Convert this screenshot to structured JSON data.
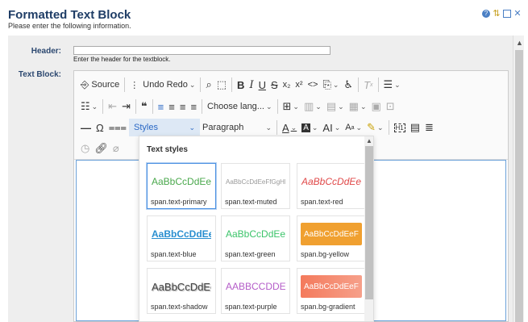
{
  "page": {
    "title": "Formatted Text Block",
    "subtitle": "Please enter the following information."
  },
  "form": {
    "header_label": "Header:",
    "header_value": "",
    "header_hint": "Enter the header for the textblock.",
    "textblock_label": "Text Block:"
  },
  "toolbar": {
    "source_label": "Source",
    "undo_redo_label": "Undo Redo",
    "language_label": "Choose lang...",
    "styles_label": "Styles",
    "paragraph_label": "Paragraph"
  },
  "styles_dropdown": {
    "title": "Text styles",
    "items": [
      {
        "preview": "AaBbCcDdEeF",
        "caption": "span.text-primary",
        "color": "#4aa84c"
      },
      {
        "preview": "AaBbCcDdEeFfGgHh",
        "caption": "span.text-muted",
        "color": "#9a9a9a"
      },
      {
        "preview": "AaBbCcDdEeF",
        "caption": "span.text-red",
        "color": "#e04848"
      },
      {
        "preview": "AaBbCcDdEe",
        "caption": "span.text-blue",
        "color": "#2a8fd0"
      },
      {
        "preview": "AaBbCcDdEeF",
        "caption": "span.text-green",
        "color": "#3cc46a"
      },
      {
        "preview": "AaBbCcDdEeF",
        "caption": "span.bg-yellow",
        "color": "#f0a030"
      },
      {
        "preview": "AaBbCcDdEe",
        "caption": "span.text-shadow",
        "color": "#444444"
      },
      {
        "preview": "AABBCCDDEE",
        "caption": "span.text-purple",
        "color": "#b45cc8"
      },
      {
        "preview": "AaBbCcDdEeF",
        "caption": "span.bg-gradient",
        "color": "#f47a5c"
      }
    ]
  },
  "colors": {
    "title": "#1f3d66",
    "label": "#2c4870",
    "accent": "#2a68c5"
  }
}
